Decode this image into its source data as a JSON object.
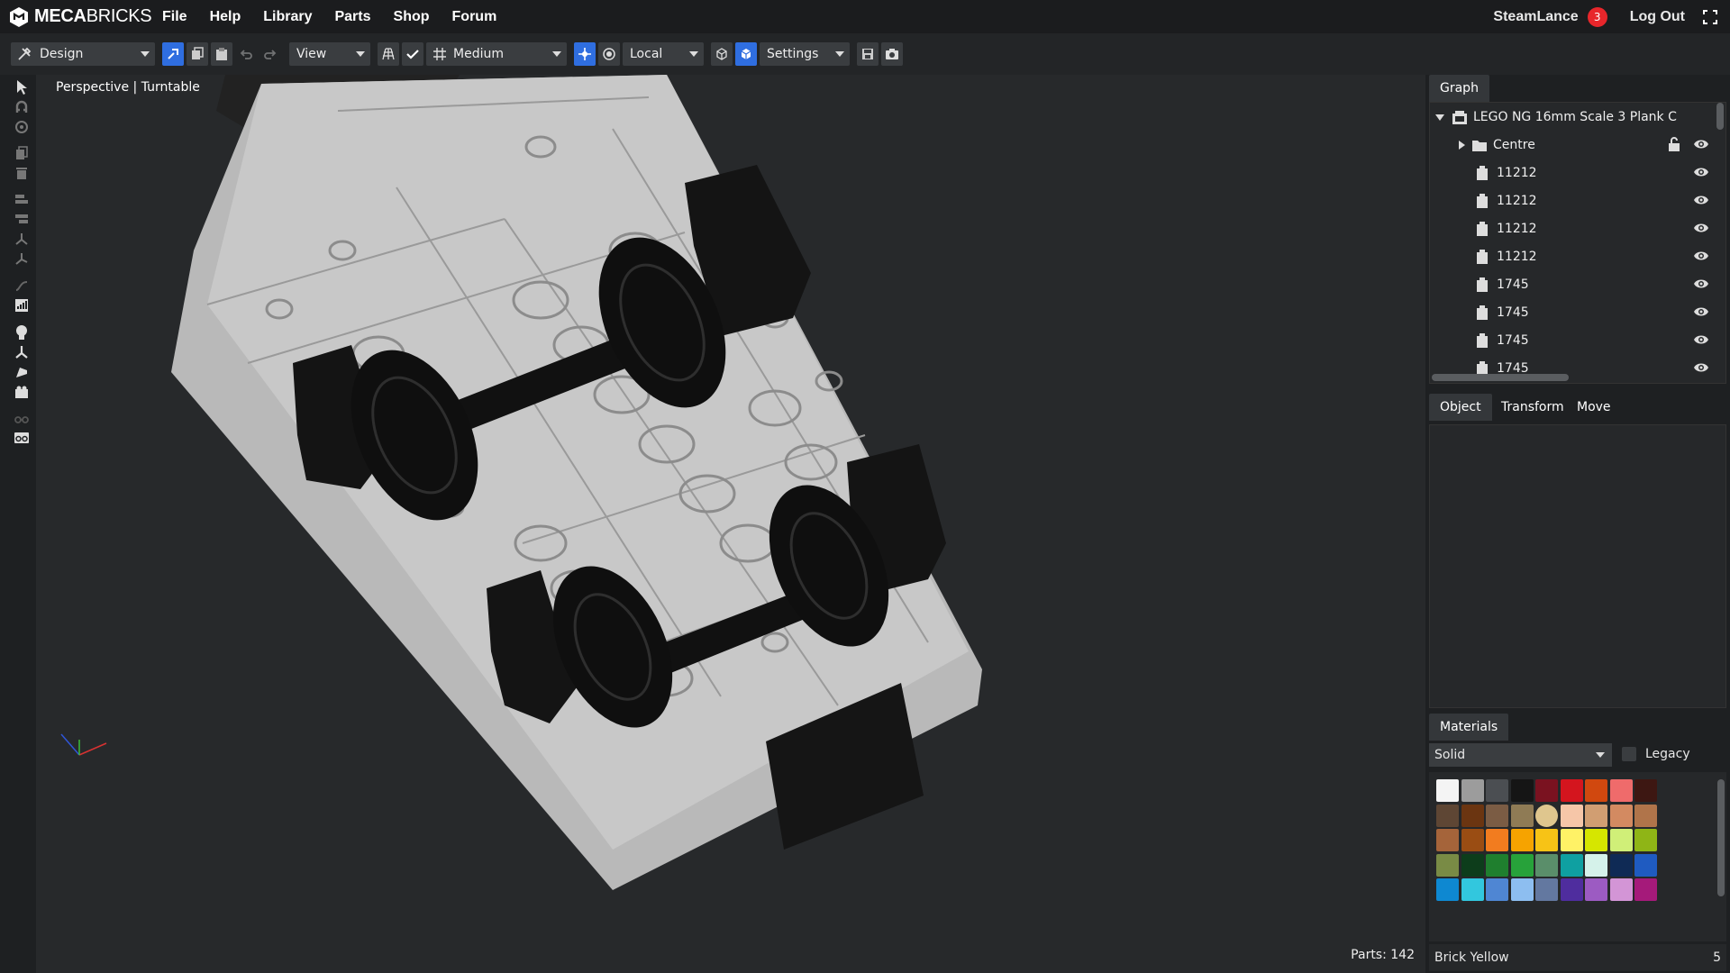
{
  "app": {
    "brand_bold": "MECA",
    "brand_rest": "BRICKS"
  },
  "menu": [
    "File",
    "Help",
    "Library",
    "Parts",
    "Shop",
    "Forum"
  ],
  "user": {
    "name": "SteamLance",
    "notifications": "3",
    "logout": "Log Out"
  },
  "toolbar": {
    "mode": "Design",
    "view": "View",
    "quality": "Medium",
    "space": "Local",
    "settings": "Settings"
  },
  "viewport": {
    "label": "Perspective | Turntable",
    "parts": "Parts: 142"
  },
  "graph": {
    "tab": "Graph",
    "root": "LEGO NG 16mm Scale 3 Plank C",
    "folder": "Centre",
    "items": [
      "11212",
      "11212",
      "11212",
      "11212",
      "1745",
      "1745",
      "1745",
      "1745"
    ]
  },
  "props_tabs": [
    "Object",
    "Transform",
    "Move"
  ],
  "materials": {
    "tab": "Materials",
    "type": "Solid",
    "legacy_label": "Legacy",
    "selected_name": "Brick Yellow",
    "selected_id": "5",
    "swatches": [
      [
        "#f4f4f4",
        "#9c9c9c",
        "#4b4e52",
        "#151515",
        "#7a1220",
        "#d4151e",
        "#d1480f",
        "#ef6b6b",
        "#3d1712"
      ],
      [
        "#5e4634",
        "#6b3511",
        "#7b5c44",
        "#8f7b55",
        "#dfc68e",
        "#f6c6a8",
        "#d19e72",
        "#d38a61",
        "#b0744a"
      ],
      [
        "#a5643a",
        "#9a4d13",
        "#f27c1f",
        "#f6a300",
        "#f7c316",
        "#fff266",
        "#d6e600",
        "#d0ef78",
        "#8fb516"
      ],
      [
        "#798b45",
        "#0d3d1b",
        "#1f7f2e",
        "#27a23a",
        "#5a8e6a",
        "#0fa0a1",
        "#d5f2ea",
        "#0f2a55",
        "#1f5bc1"
      ],
      [
        "#0e88d1",
        "#32c7de",
        "#4f86d3",
        "#8dbef0",
        "#6378a0",
        "#4f2d9e",
        "#9c5bc2",
        "#d395d6",
        "#a51a7a"
      ]
    ]
  },
  "icons": {
    "logo": "mecabricks-logo-icon",
    "fullscreen": "fullscreen-icon",
    "eye": "eye-icon",
    "lock": "unlock-icon",
    "folder": "folder-icon",
    "brick": "brick-icon"
  }
}
